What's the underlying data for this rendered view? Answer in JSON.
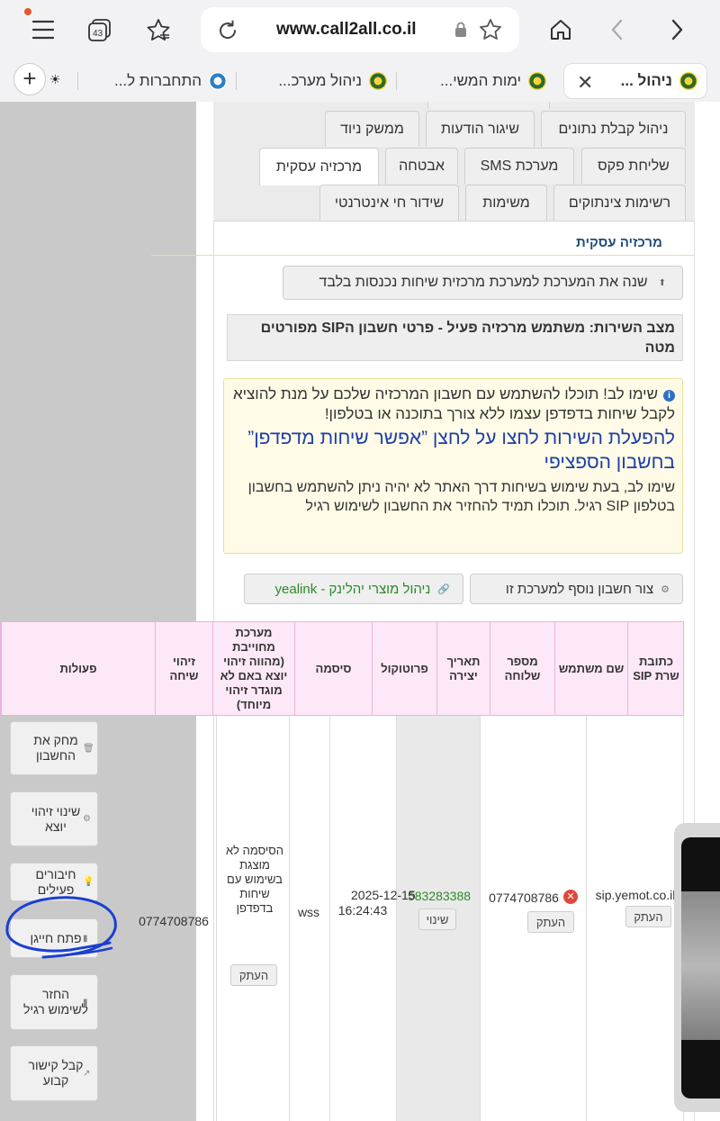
{
  "browser": {
    "url": "www.call2all.co.il",
    "tab_count": "43",
    "tabs": [
      {
        "label": "ניהול ..."
      },
      {
        "label": "ימות המשי..."
      },
      {
        "label": "ניהול מערכ..."
      },
      {
        "label": "התחברות ל..."
      }
    ],
    "close_glyph": "✕",
    "new_tab_glyph": "+"
  },
  "nav": {
    "row1": [
      "ניהול קבלת נתונים",
      "שיגור הודעות",
      "ממשק ניוד"
    ],
    "row2": [
      "שליחת פקס",
      "מערכת SMS",
      "אבטחה",
      "מרכזיה עסקית"
    ],
    "row3": [
      "רשימות צינתוקים",
      "משימות",
      "שידור חי אינטרנטי"
    ],
    "active": "מרכזיה עסקית"
  },
  "section_title": "מרכזיה עסקית",
  "switch_button": "שנה את המערכת למערכת מרכזית שיחות נכנסות בלבד",
  "status": "מצב השירות: משתמש מרכזיה פעיל - פרטי חשבון הSIP מפורטים מטה",
  "notice": {
    "info_glyph": "i",
    "line1": "שימו לב! תוכלו להשתמש עם חשבון המרכזיה שלכם על מנת להוציא לקבל שיחות בדפדפן עצמו ללא צורך בתוכנה או בטלפון!",
    "highlight": "להפעלת השירות לחצו על לחצן ”אפשר שיחות מדפדפן” בחשבון הספציפי",
    "line2": "שימו לב, בעת שימוש בשיחות דרך האתר לא יהיה ניתן להשתמש בחשבון בטלפון SIP רגיל. תוכלו תמיד להחזיר את החשבון לשימוש רגיל"
  },
  "buttons": {
    "add_account": "צור חשבון נוסף למערכת זו",
    "yealink": "ניהול מוצרי יהלינק - yealink"
  },
  "table": {
    "headers": {
      "sip_server": "כתובת שרת SIP",
      "username": "שם משתמש",
      "extension": "מספר שלוחה",
      "created": "תאריך יצירה",
      "protocol": "פרוטוקול",
      "password": "סיסמה",
      "required_system": "מערכת מחוייבת (מהווה זיהוי יוצא באם לא מוגדר זיהוי מיוחד)",
      "caller_id": "זיהוי שיחה",
      "actions": "פעולות"
    },
    "row": {
      "sip_server": "sip.yemot.co.il",
      "username": "0774708786",
      "extension": "583283388",
      "created_date": "2025-12-15",
      "created_time": "16:24:43",
      "protocol": "wss",
      "password": "הסיסמה לא מוצגת בשימוש עם שיחות בדפדפן",
      "caller_id": "0774708786",
      "copy_label": "העתק",
      "change_label": "שינוי"
    },
    "actions": [
      {
        "label": "מחק את החשבון",
        "icon": "trash-icon"
      },
      {
        "label": "שינוי זיהוי יוצא",
        "icon": "gear-icon"
      },
      {
        "label": "חיבורים פעילים",
        "icon": "bulb-icon"
      },
      {
        "label": "פתח חייגן",
        "icon": "bars-icon"
      },
      {
        "label": "החזר לשימוש רגיל",
        "icon": "bars-icon"
      },
      {
        "label": "קבל קישור קבוע",
        "icon": "link-icon"
      }
    ]
  },
  "colors": {
    "header_pink": "#fde8f7",
    "notice_yellow": "#fffbe6",
    "highlight_blue": "#1c3ea8",
    "green_text": "#2a8a2a",
    "annotation_blue": "#1b3fd1"
  }
}
